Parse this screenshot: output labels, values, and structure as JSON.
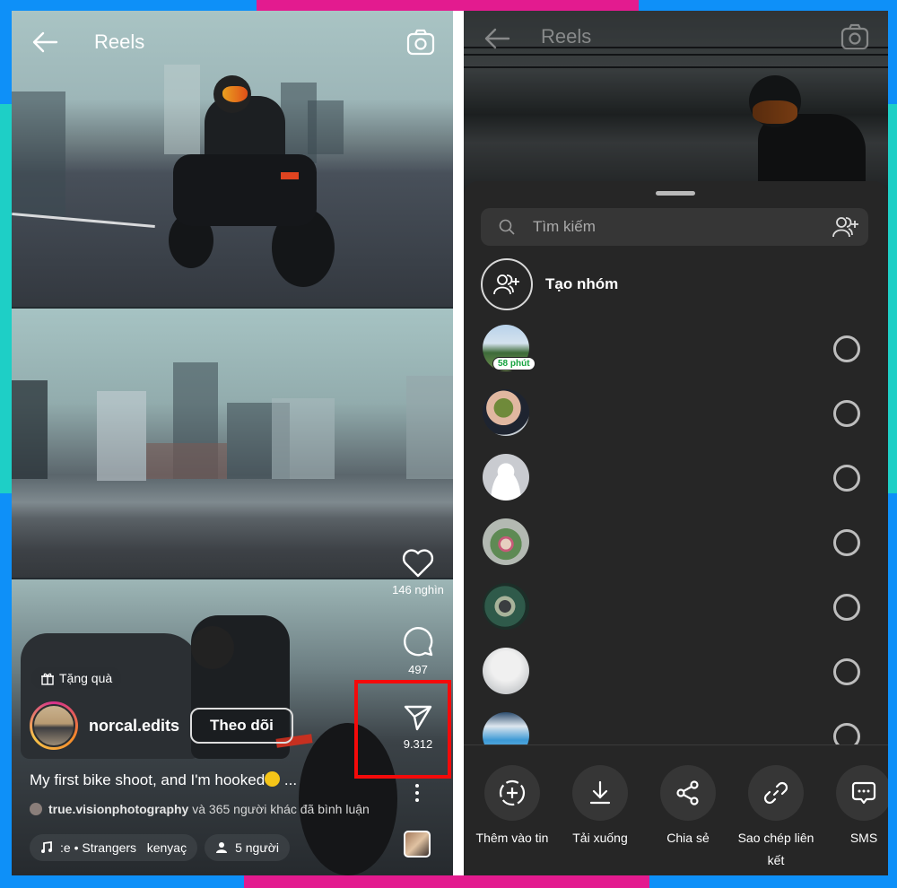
{
  "colors": {
    "frame_blue": "#0e90f8",
    "frame_pink": "#e31b8f",
    "frame_cyan": "#1ecfc6",
    "highlight_red": "#f40a0a",
    "sheet_bg": "#262626",
    "badge_green": "#16a33f"
  },
  "left_screen": {
    "header": {
      "title": "Reels",
      "back_icon": "arrow-left-icon",
      "camera_icon": "camera-icon"
    },
    "actions": {
      "like_count": "146 nghìn",
      "comment_count": "497",
      "share_count": "9.312"
    },
    "gift_label": "Tặng quà",
    "author": {
      "username": "norcal.edits",
      "follow_label": "Theo dõi"
    },
    "caption": "My first bike shoot, and I'm hooked",
    "caption_more": " ...",
    "comments": {
      "user": "true.visionphotography",
      "rest": "và 365 người khác đã bình luận"
    },
    "chips": {
      "music": ":e • Strangers   kenyaç",
      "people": "5 người"
    }
  },
  "right_screen": {
    "header": {
      "title": "Reels"
    },
    "search": {
      "placeholder": "Tìm kiếm"
    },
    "create_group_label": "Tạo nhóm",
    "contacts": [
      {
        "badge": "58 phút",
        "selected": false
      },
      {
        "badge": null,
        "selected": false
      },
      {
        "badge": null,
        "selected": false
      },
      {
        "badge": null,
        "selected": false
      },
      {
        "badge": null,
        "selected": false
      },
      {
        "badge": null,
        "selected": false
      },
      {
        "badge": null,
        "selected": false
      }
    ],
    "share_options": [
      {
        "label": "Thêm vào tin",
        "icon": "add-story-icon"
      },
      {
        "label": "Tải xuống",
        "icon": "download-icon"
      },
      {
        "label": "Chia sẻ",
        "icon": "share-icon"
      },
      {
        "label": "Sao chép liên kết",
        "icon": "link-icon"
      },
      {
        "label": "SMS",
        "icon": "sms-icon"
      }
    ]
  }
}
